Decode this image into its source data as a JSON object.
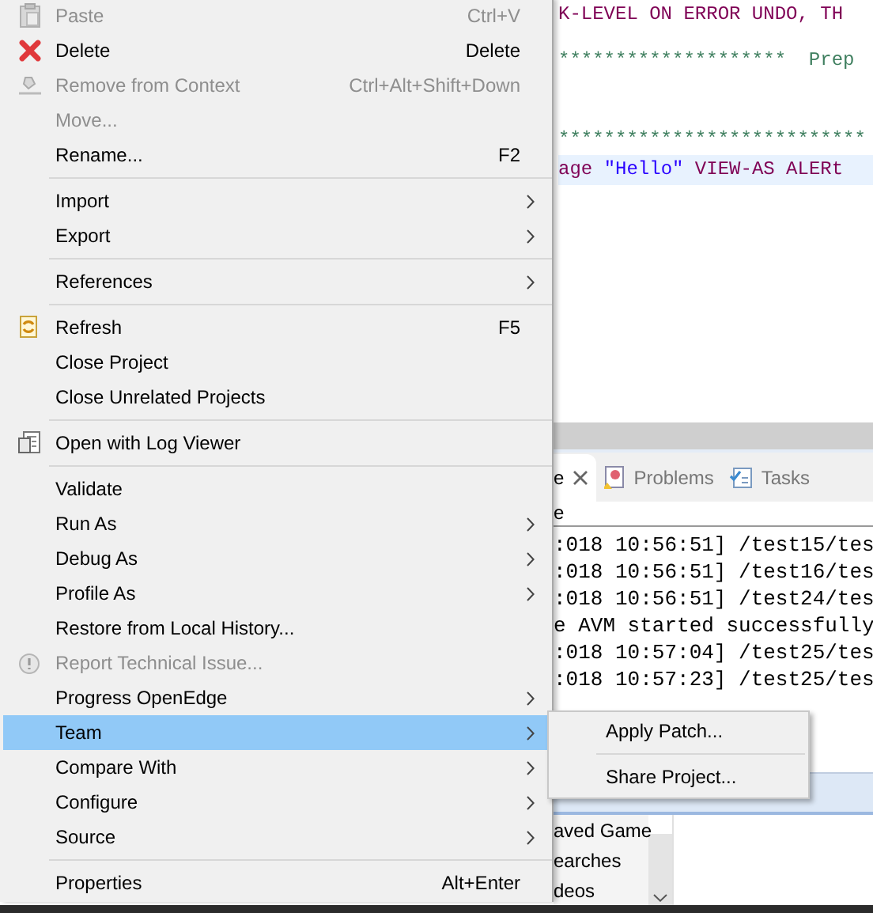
{
  "context_menu": {
    "items": [
      {
        "kind": "item",
        "label": "Paste",
        "shortcut": "Ctrl+V",
        "submenu": false,
        "disabled": true,
        "selected": false
      },
      {
        "kind": "item",
        "label": "Delete",
        "shortcut": "Delete",
        "submenu": false,
        "disabled": false,
        "selected": false
      },
      {
        "kind": "item",
        "label": "Remove from Context",
        "shortcut": "Ctrl+Alt+Shift+Down",
        "submenu": false,
        "disabled": true,
        "selected": false
      },
      {
        "kind": "item",
        "label": "Move...",
        "submenu": false,
        "disabled": true,
        "selected": false
      },
      {
        "kind": "item",
        "label": "Rename...",
        "shortcut": "F2",
        "submenu": false,
        "disabled": false,
        "selected": false
      },
      {
        "kind": "separator"
      },
      {
        "kind": "item",
        "label": "Import",
        "submenu": true,
        "disabled": false,
        "selected": false
      },
      {
        "kind": "item",
        "label": "Export",
        "submenu": true,
        "disabled": false,
        "selected": false
      },
      {
        "kind": "separator"
      },
      {
        "kind": "item",
        "label": "References",
        "submenu": true,
        "disabled": false,
        "selected": false
      },
      {
        "kind": "separator"
      },
      {
        "kind": "item",
        "label": "Refresh",
        "shortcut": "F5",
        "submenu": false,
        "disabled": false,
        "selected": false
      },
      {
        "kind": "item",
        "label": "Close Project",
        "submenu": false,
        "disabled": false,
        "selected": false
      },
      {
        "kind": "item",
        "label": "Close Unrelated Projects",
        "submenu": false,
        "disabled": false,
        "selected": false
      },
      {
        "kind": "separator"
      },
      {
        "kind": "item",
        "label": "Open with Log Viewer",
        "submenu": false,
        "disabled": false,
        "selected": false
      },
      {
        "kind": "separator"
      },
      {
        "kind": "item",
        "label": "Validate",
        "submenu": false,
        "disabled": false,
        "selected": false
      },
      {
        "kind": "item",
        "label": "Run As",
        "submenu": true,
        "disabled": false,
        "selected": false
      },
      {
        "kind": "item",
        "label": "Debug As",
        "submenu": true,
        "disabled": false,
        "selected": false
      },
      {
        "kind": "item",
        "label": "Profile As",
        "submenu": true,
        "disabled": false,
        "selected": false
      },
      {
        "kind": "item",
        "label": "Restore from Local History...",
        "submenu": false,
        "disabled": false,
        "selected": false
      },
      {
        "kind": "item",
        "label": "Report Technical Issue...",
        "submenu": false,
        "disabled": true,
        "selected": false
      },
      {
        "kind": "item",
        "label": "Progress OpenEdge",
        "submenu": true,
        "disabled": false,
        "selected": false
      },
      {
        "kind": "item",
        "label": "Team",
        "submenu": true,
        "disabled": false,
        "selected": true
      },
      {
        "kind": "item",
        "label": "Compare With",
        "submenu": true,
        "disabled": false,
        "selected": false
      },
      {
        "kind": "item",
        "label": "Configure",
        "submenu": true,
        "disabled": false,
        "selected": false
      },
      {
        "kind": "item",
        "label": "Source",
        "submenu": true,
        "disabled": false,
        "selected": false
      },
      {
        "kind": "separator"
      },
      {
        "kind": "item",
        "label": "Properties",
        "shortcut": "Alt+Enter",
        "submenu": false,
        "disabled": false,
        "selected": false
      }
    ]
  },
  "submenu": {
    "items": [
      {
        "kind": "item",
        "label": "Apply Patch..."
      },
      {
        "kind": "separator"
      },
      {
        "kind": "item",
        "label": "Share Project..."
      }
    ]
  },
  "editor": {
    "lines": [
      {
        "highlighted": false,
        "tokens": [
          {
            "kind": "keyword",
            "text": "K-LEVEL ON ERROR UNDO, TH"
          }
        ]
      },
      {
        "highlighted": false,
        "tokens": [
          {
            "kind": "comment",
            "text": "********************  Prep"
          }
        ]
      },
      {
        "highlighted": false,
        "tokens": [
          {
            "kind": "comment",
            "text": "***************************"
          }
        ]
      },
      {
        "highlighted": true,
        "tokens": [
          {
            "kind": "keyword",
            "text": "age "
          },
          {
            "kind": "string",
            "text": "\"Hello\""
          },
          {
            "kind": "keyword",
            "text": " VIEW-AS ALERt"
          }
        ]
      }
    ]
  },
  "console": {
    "tabs": [
      {
        "label": "e",
        "selected": true
      },
      {
        "label": "Problems",
        "selected": false
      },
      {
        "label": "Tasks",
        "selected": false
      }
    ],
    "title": "e",
    "lines": [
      ":018 10:56:51] /test15/tes",
      ":018 10:56:51] /test16/tes",
      ":018 10:56:51] /test24/tes",
      "e AVM started successfully",
      ":018 10:57:04] /test25/tes",
      ":018 10:57:23] /test25/tes"
    ]
  },
  "explorer": {
    "items": [
      "aved Game",
      "earches",
      "deos"
    ]
  }
}
